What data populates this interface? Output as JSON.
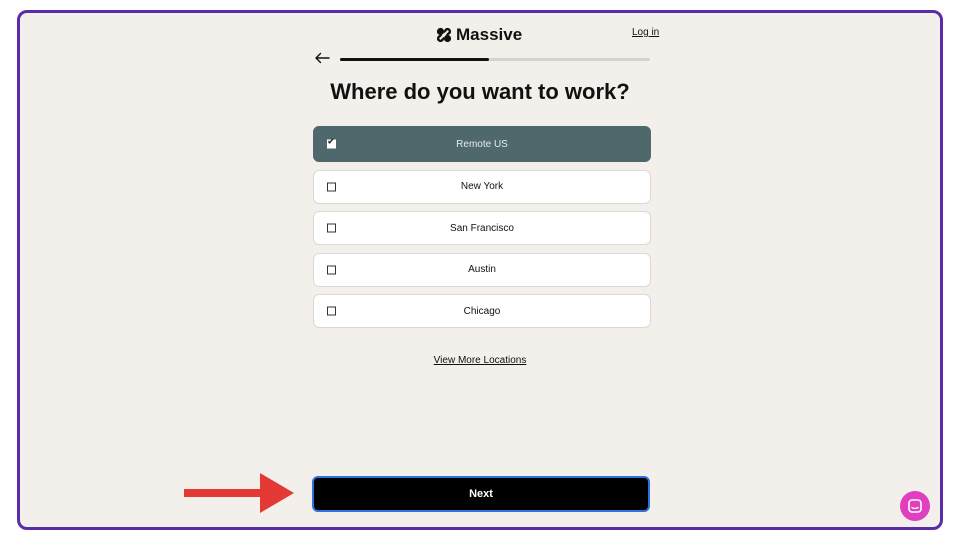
{
  "header": {
    "brand": "Massive",
    "login_label": "Log in"
  },
  "progress": {
    "fraction": 0.48
  },
  "question": "Where do you want to work?",
  "locations": [
    {
      "label": "Remote US",
      "checked": true
    },
    {
      "label": "New York",
      "checked": false
    },
    {
      "label": "San Francisco",
      "checked": false
    },
    {
      "label": "Austin",
      "checked": false
    },
    {
      "label": "Chicago",
      "checked": false
    }
  ],
  "view_more_label": "View More Locations",
  "next_label": "Next",
  "colors": {
    "frame_border": "#5b2ca6",
    "selected_bg": "#4f686b",
    "next_bg": "#000000",
    "next_border": "#2f6fde",
    "annotation_arrow": "#e53935",
    "chat_button": "#e03fbf"
  },
  "icons": {
    "back": "arrow-left-icon",
    "logo": "clover-logo-icon",
    "chat": "chat-icon"
  }
}
